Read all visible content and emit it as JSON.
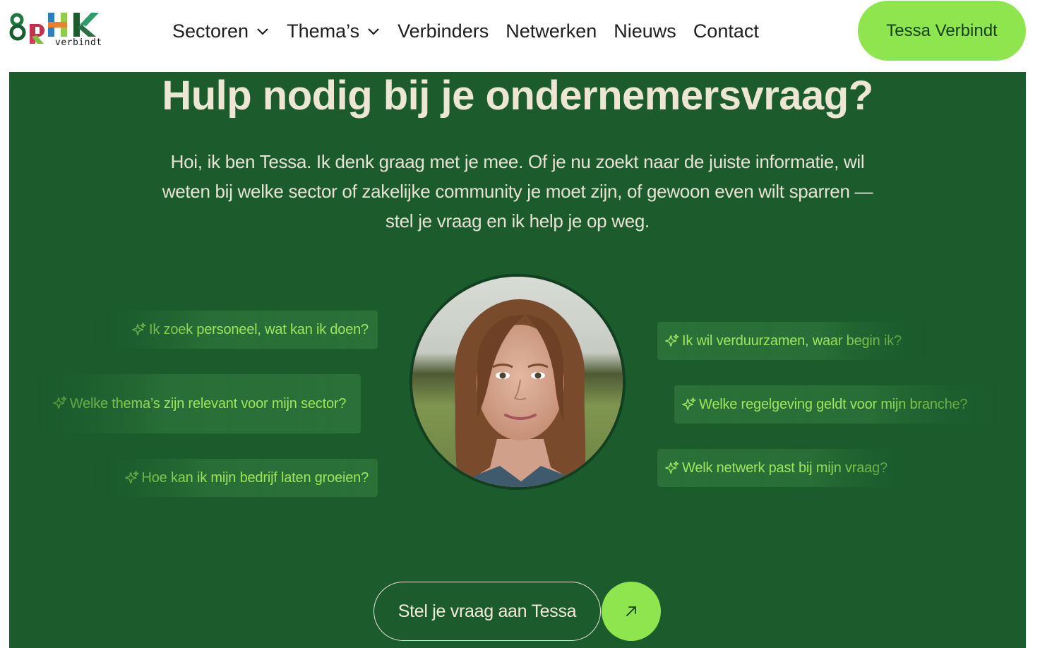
{
  "brand": {
    "logo_sub": "verbindt",
    "logo_letters": "8RHK"
  },
  "nav": {
    "items": [
      {
        "label": "Sectoren",
        "has_dropdown": true
      },
      {
        "label": "Thema’s",
        "has_dropdown": true
      },
      {
        "label": "Verbinders",
        "has_dropdown": false
      },
      {
        "label": "Netwerken",
        "has_dropdown": false
      },
      {
        "label": "Nieuws",
        "has_dropdown": false
      },
      {
        "label": "Contact",
        "has_dropdown": false
      }
    ],
    "cta": "Tessa Verbindt"
  },
  "hero": {
    "title": "Hulp nodig bij je ondernemersvraag?",
    "intro": "Hoi, ik ben Tessa. Ik denk graag met je mee. Of je nu zoekt naar de juiste informatie, wil weten bij welke sector of zakelijke community je moet zijn, of gewoon even wilt sparren — stel je vraag en ik help je op weg.",
    "avatar_alt": "Tessa",
    "questions_left": [
      "Ik zoek personeel, wat kan ik doen?",
      "Welke thema’s zijn relevant voor mijn sector?",
      "Hoe kan ik mijn bedrijf laten groeien?"
    ],
    "questions_right": [
      "Ik wil verduurzamen, waar begin ik?",
      "Welke regelgeving geldt voor mijn branche?",
      "Welk netwerk past bij mijn vraag?"
    ],
    "ask_button": "Stel je vraag aan Tessa",
    "ask_icon": "arrow-up-right-icon"
  },
  "colors": {
    "hero_bg": "#1b5b2c",
    "accent_green": "#8ee54d",
    "chip_bg": "#2b7039",
    "chip_text": "#9ee65b",
    "title_cream": "#ece6d3"
  }
}
